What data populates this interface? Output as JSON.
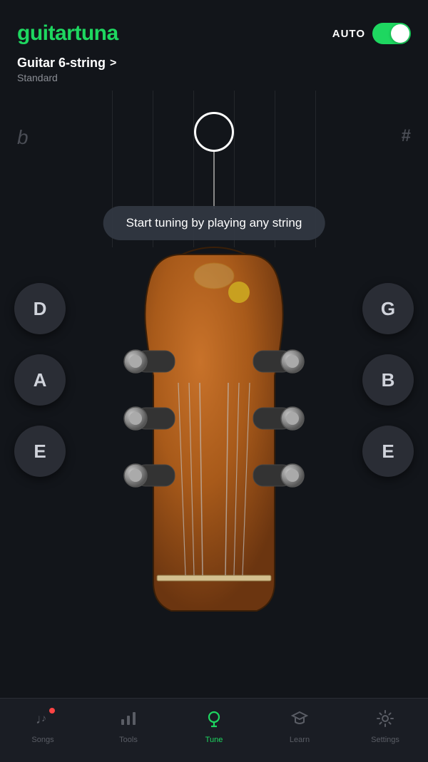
{
  "header": {
    "logo_guitar": "guitar",
    "logo_tuna": "tuna",
    "auto_label": "AUTO",
    "toggle_on": true
  },
  "instrument": {
    "name": "Guitar 6-string",
    "chevron": ">",
    "tuning": "Standard"
  },
  "tuner": {
    "flat_symbol": "b",
    "sharp_symbol": "#",
    "hint_text": "Start tuning by playing any string"
  },
  "strings": {
    "left": [
      "D",
      "A",
      "E"
    ],
    "right": [
      "G",
      "B",
      "E"
    ]
  },
  "nav": {
    "items": [
      {
        "id": "songs",
        "label": "Songs",
        "active": false,
        "has_dot": true
      },
      {
        "id": "tools",
        "label": "Tools",
        "active": false,
        "has_dot": false
      },
      {
        "id": "tune",
        "label": "Tune",
        "active": true,
        "has_dot": false
      },
      {
        "id": "learn",
        "label": "Learn",
        "active": false,
        "has_dot": false
      },
      {
        "id": "settings",
        "label": "Settings",
        "active": false,
        "has_dot": false
      }
    ]
  },
  "colors": {
    "accent_green": "#1ed760",
    "background": "#12151a",
    "nav_bg": "#1a1d24",
    "gold": "#c8a020",
    "inactive": "#5a5d65"
  }
}
